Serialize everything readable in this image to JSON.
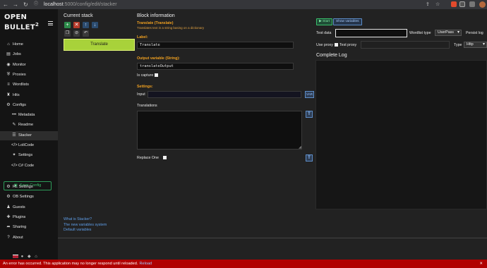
{
  "browser": {
    "url_host": "localhost",
    "url_rest": ":5000/config/edit/stacker"
  },
  "app": {
    "logo_line1": "OPEN",
    "logo_line2": "BULLET",
    "logo_version": "2"
  },
  "sidebar": {
    "items": [
      {
        "label": "Home",
        "icon": "home-icon",
        "glyph": "⌂"
      },
      {
        "label": "Jobs",
        "icon": "jobs-icon",
        "glyph": "▤"
      },
      {
        "label": "Monitor",
        "icon": "monitor-icon",
        "glyph": "◉"
      },
      {
        "label": "Proxies",
        "icon": "proxies-icon",
        "glyph": "⛨"
      },
      {
        "label": "Wordlists",
        "icon": "wordlists-icon",
        "glyph": "≡"
      },
      {
        "label": "Hits",
        "icon": "hits-icon",
        "glyph": "♜"
      },
      {
        "label": "Configs",
        "icon": "configs-icon",
        "glyph": "⚙"
      }
    ],
    "sub_items": [
      {
        "label": "Metadata",
        "icon": "metadata-icon",
        "glyph": "•••"
      },
      {
        "label": "Readme",
        "icon": "readme-icon",
        "glyph": "✎"
      },
      {
        "label": "Stacker",
        "icon": "stacker-icon",
        "glyph": "☰"
      },
      {
        "label": "LoliCode",
        "icon": "lolicode-icon",
        "glyph": "</>"
      },
      {
        "label": "Settings",
        "icon": "settings-icon",
        "glyph": "✦"
      },
      {
        "label": "C# Code",
        "icon": "csharp-icon",
        "glyph": "</>"
      }
    ],
    "save_config": "Save Config",
    "bottom_items": [
      {
        "label": "RL Settings",
        "icon": "rl-settings-icon",
        "glyph": "⚙"
      },
      {
        "label": "OB Settings",
        "icon": "ob-settings-icon",
        "glyph": "⚙"
      },
      {
        "label": "Guests",
        "icon": "guests-icon",
        "glyph": "♟"
      },
      {
        "label": "Plugins",
        "icon": "plugins-icon",
        "glyph": "✚"
      },
      {
        "label": "Sharing",
        "icon": "sharing-icon",
        "glyph": "➦"
      },
      {
        "label": "About",
        "icon": "about-icon",
        "glyph": "?"
      }
    ]
  },
  "stack": {
    "title": "Current stack",
    "blocks": [
      {
        "label": "Translate"
      }
    ],
    "links": [
      "What is Stacker?",
      "The new variables system",
      "Default variables"
    ]
  },
  "block_info": {
    "title": "Block information",
    "block_name": "Translate (Translate)",
    "block_desc": "Translates text in a string basing on a dictionary",
    "label_title": "Label:",
    "label_value": "Translate",
    "output_title": "Output variable (String):",
    "output_value": "translateOutput",
    "is_capture": "Is capture",
    "settings_title": "Settings:",
    "input_label": "Input",
    "input_value": "",
    "var_button": "VAR",
    "translations_label": "Translations",
    "translations_value": "",
    "replace_one_label": "Replace One",
    "t_button": "T"
  },
  "debugger": {
    "start": "Start",
    "show_variables": "Show variables",
    "test_data_label": "Test data",
    "test_data_value": "",
    "wordlist_type_label": "Wordlist type",
    "wordlist_type_value": "UserPass",
    "persist_log_label": "Persist log",
    "use_proxy_label": "Use proxy",
    "test_proxy_label": "Test proxy",
    "test_proxy_value": "",
    "type_label": "Type",
    "type_value": "Http",
    "complete_log_title": "Complete Log"
  },
  "status": {
    "message": "An error has occurred. This application may no longer respond until reloaded.",
    "reload": "Reload",
    "close": "✕"
  }
}
